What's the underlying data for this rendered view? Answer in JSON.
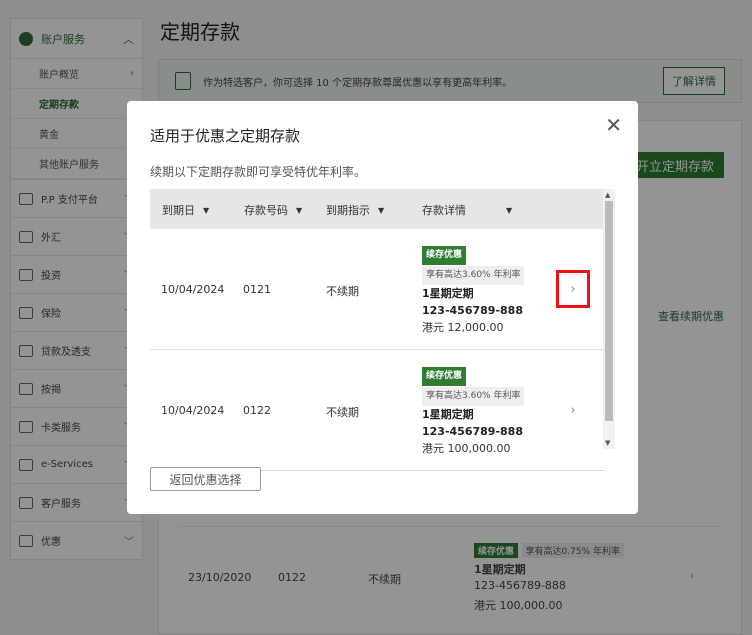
{
  "background": {
    "page_title": "定期存款",
    "sidebar": {
      "account_services": "账户服务",
      "sub_items": [
        "账户概览",
        "定期存款",
        "黄金",
        "其他账户服务"
      ],
      "items": [
        "P.P 支付平台",
        "外汇",
        "投资",
        "保险",
        "贷款及透支",
        "按揭",
        "卡类服务",
        "e-Services",
        "客户服务",
        "优惠"
      ]
    },
    "notice_text": "作为特选客户，你可选择 10 个定期存款尊属优惠以享有更高年利率。",
    "notice_button": "了解详情",
    "new_deposit_button": "开立定期存款",
    "renew_link": "查看续期优惠",
    "row": {
      "date": "23/10/2020",
      "number": "0122",
      "instruction": "不续期",
      "tag": "续存优惠",
      "rate": "享有高达0.75% 年利率",
      "term": "1星期定期",
      "account": "123-456789-888",
      "amount": "港元 100,000.00"
    }
  },
  "modal": {
    "title": "适用于优惠之定期存款",
    "description": "续期以下定期存款即可享受特优年利率。",
    "headers": [
      "到期日",
      "存款号码",
      "到期指示",
      "存款详情"
    ],
    "rows": [
      {
        "date": "10/04/2024",
        "number": "0121",
        "instruction": "不续期",
        "tag": "续存优惠",
        "rate": "享有高达3.60% 年利率",
        "term": "1星期定期",
        "account": "123-456789-888",
        "amount": "港元 12,000.00"
      },
      {
        "date": "10/04/2024",
        "number": "0122",
        "instruction": "不续期",
        "tag": "续存优惠",
        "rate": "享有高达3.60% 年利率",
        "term": "1星期定期",
        "account": "123-456789-888",
        "amount": "港元 100,000.00"
      }
    ],
    "back_button": "返回优惠选择",
    "close_symbol": "✕",
    "caret": "▼",
    "chevron": "›"
  },
  "colors": {
    "brand": "#2e7d32",
    "highlight": "#ee1111"
  }
}
